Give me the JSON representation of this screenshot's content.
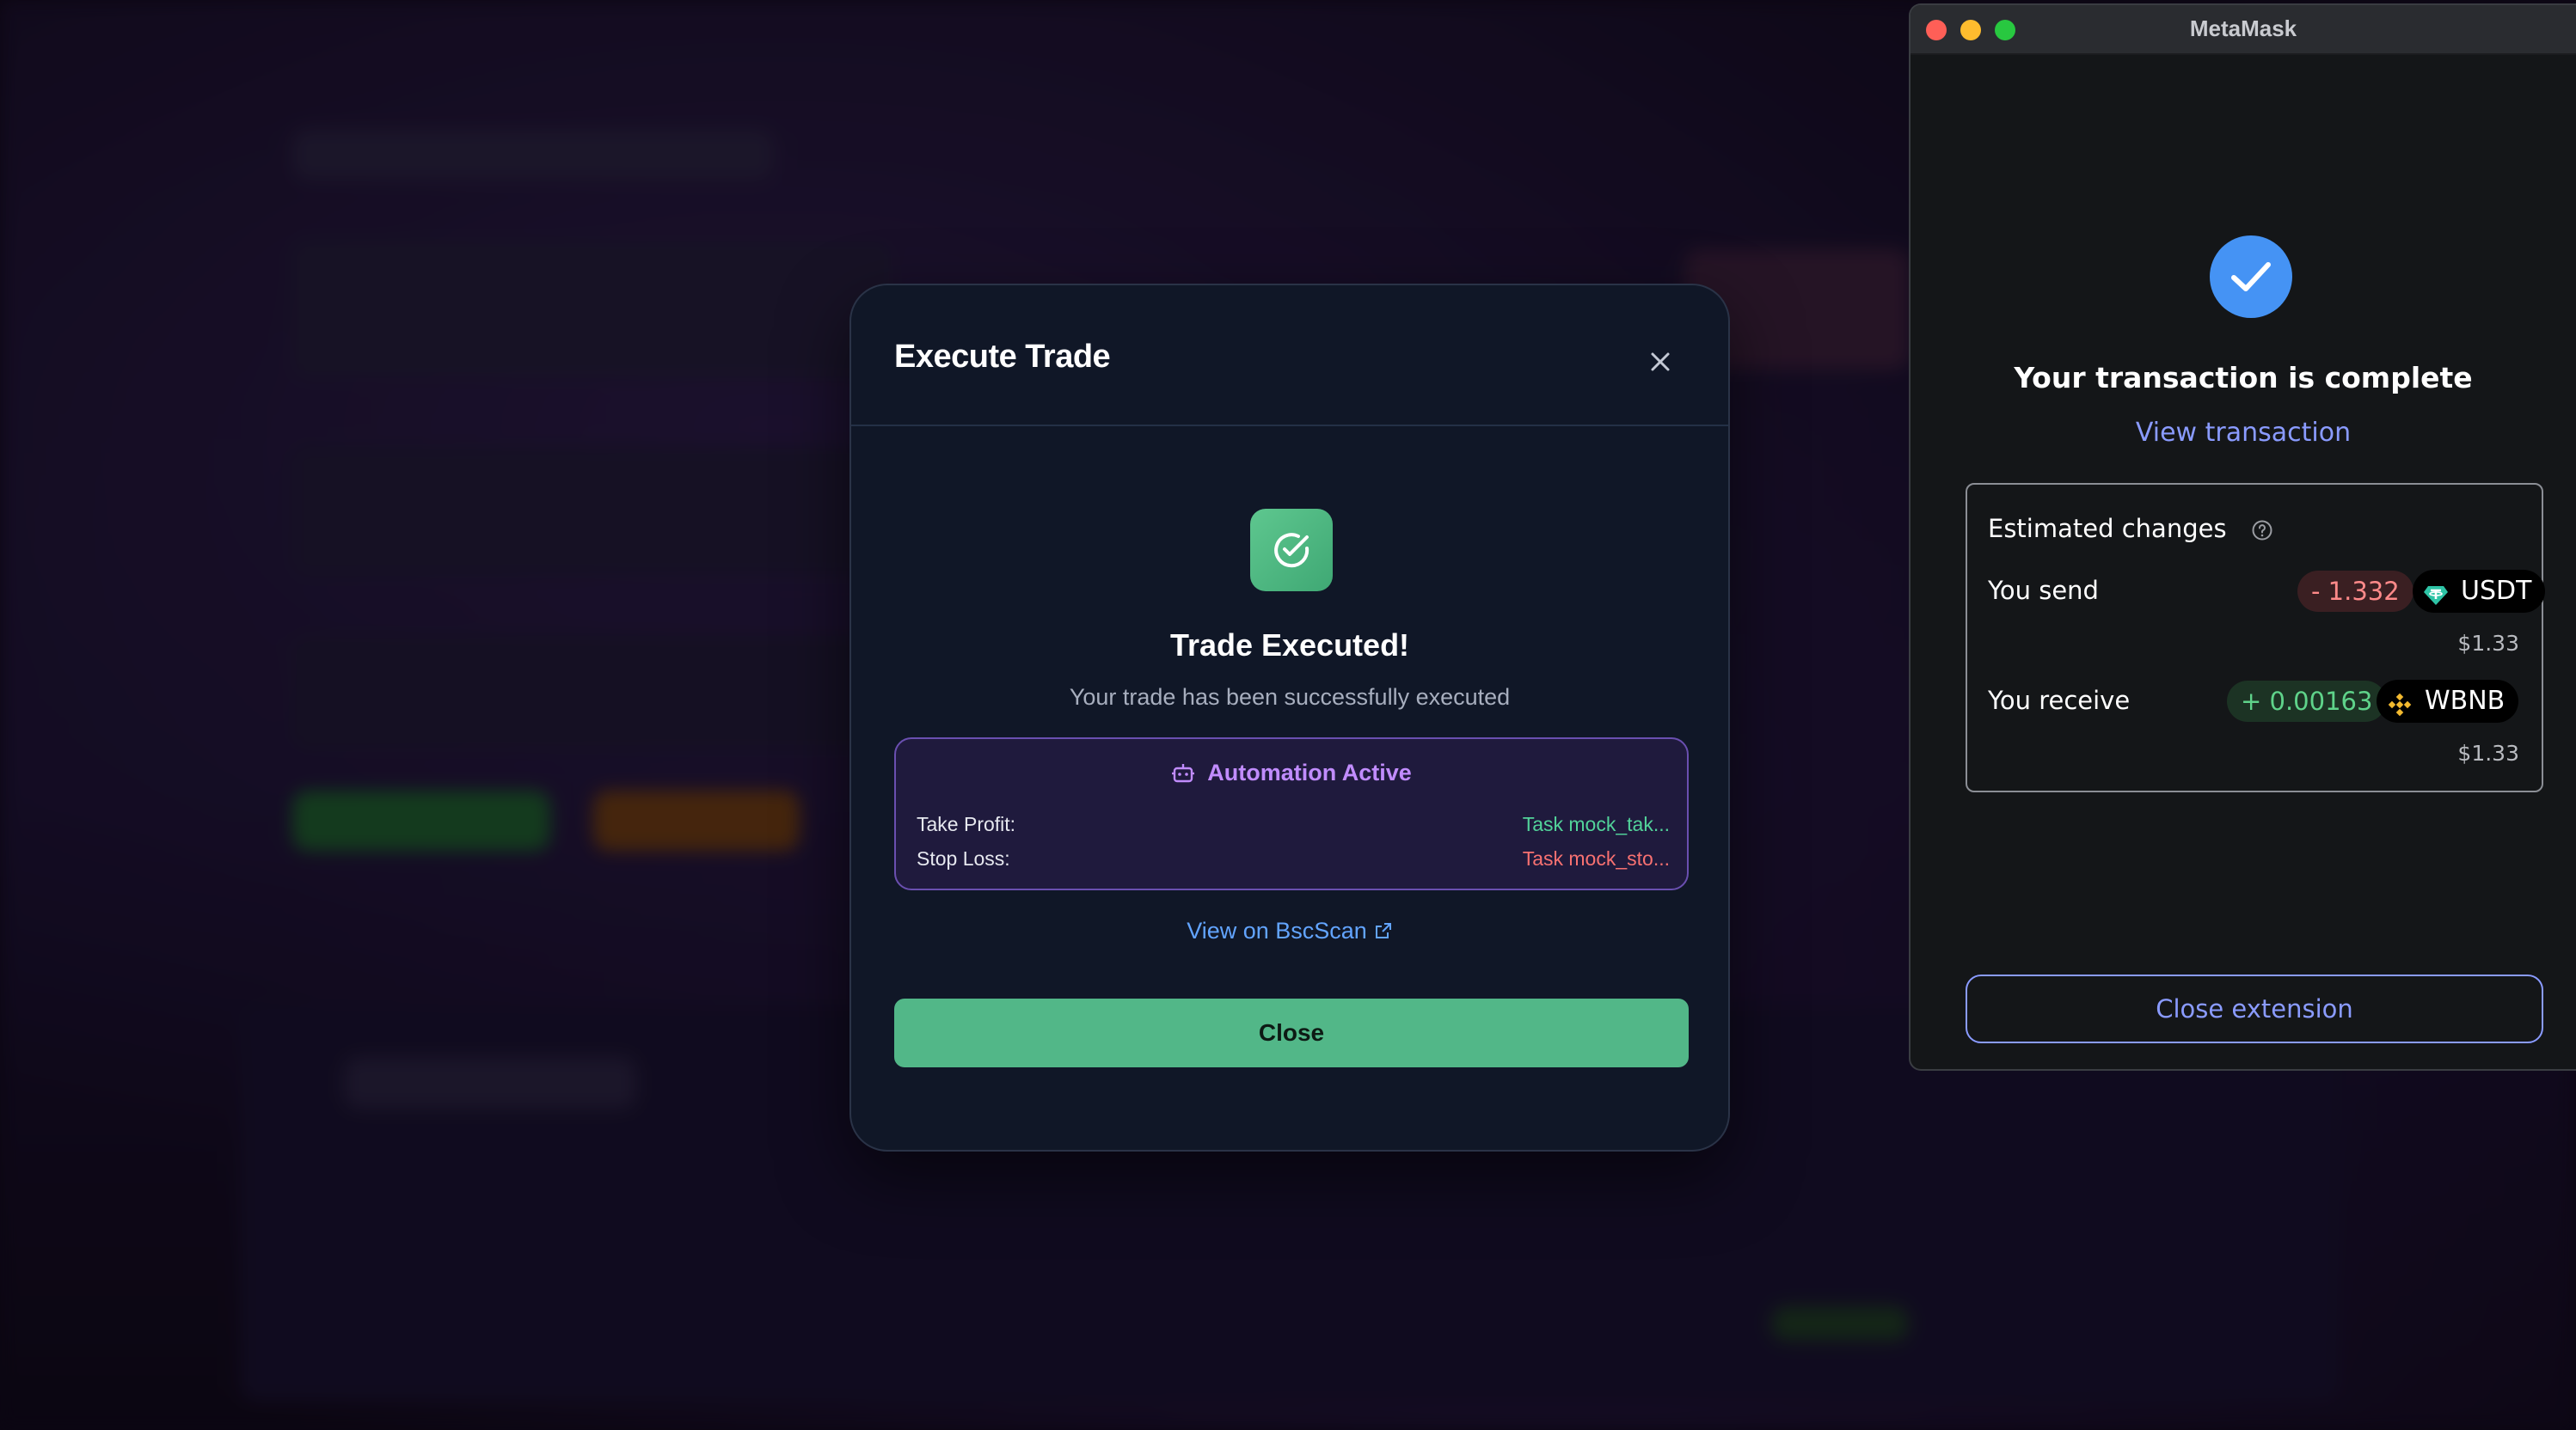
{
  "modal": {
    "title": "Execute Trade",
    "heading": "Trade Executed!",
    "subtitle": "Your trade has been successfully executed",
    "automation": {
      "title": "Automation Active",
      "rows": [
        {
          "label": "Take Profit:",
          "value": "Task mock_tak..."
        },
        {
          "label": "Stop Loss:",
          "value": "Task mock_sto..."
        }
      ]
    },
    "bscscan_link": "View on BscScan",
    "close_label": "Close"
  },
  "metamask": {
    "window_title": "MetaMask",
    "status": "Your transaction is complete",
    "view_link": "View transaction",
    "estimated_changes": {
      "title": "Estimated changes",
      "send": {
        "label": "You send",
        "amount": "- 1.332",
        "token": "USDT",
        "fiat": "$1.33"
      },
      "receive": {
        "label": "You receive",
        "amount": "+ 0.00163",
        "token": "WBNB",
        "fiat": "$1.33"
      }
    },
    "close_label": "Close extension"
  },
  "colors": {
    "accent_green": "#52b788",
    "automation_purple": "#c18cff",
    "link_blue": "#62a4ff",
    "metamask_link": "#8a9bff",
    "tp_green": "#52d39a",
    "sl_red": "#f87171"
  },
  "icons": {
    "close": "close-icon",
    "success": "check-circle-icon",
    "robot": "robot-icon",
    "external": "external-link-icon",
    "mm_check": "check-icon",
    "info": "question-circle-icon",
    "usdt": "usdt-token-icon",
    "wbnb": "bnb-token-icon"
  }
}
